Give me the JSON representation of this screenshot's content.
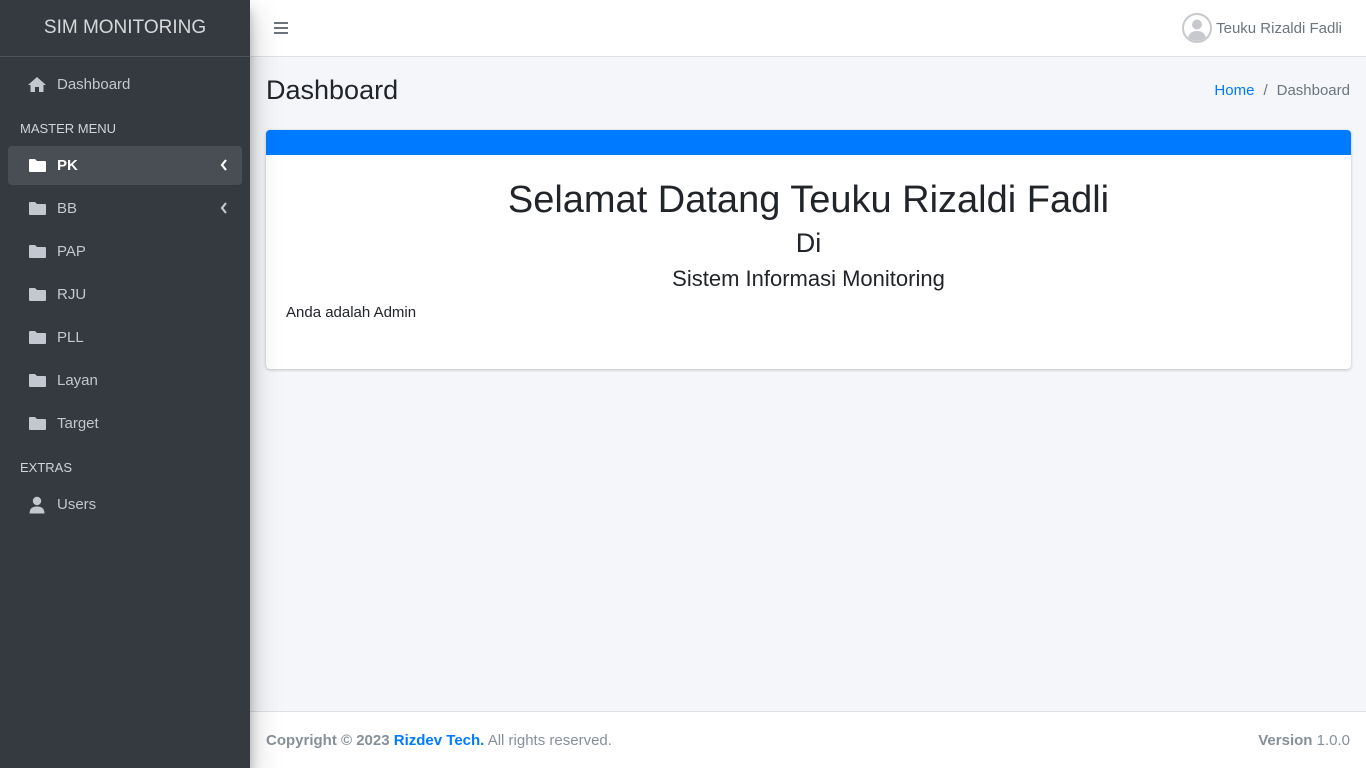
{
  "brand": {
    "title": "SIM MONITORING"
  },
  "sidebar": {
    "dashboard": {
      "label": "Dashboard",
      "icon": "home-icon"
    },
    "master_header": "MASTER MENU",
    "items": [
      {
        "label": "PK",
        "icon": "folder-icon",
        "active": true,
        "has_submenu": true
      },
      {
        "label": "BB",
        "icon": "folder-icon",
        "active": false,
        "has_submenu": true
      },
      {
        "label": "PAP",
        "icon": "folder-icon",
        "active": false,
        "has_submenu": false
      },
      {
        "label": "RJU",
        "icon": "folder-icon",
        "active": false,
        "has_submenu": false
      },
      {
        "label": "PLL",
        "icon": "folder-icon",
        "active": false,
        "has_submenu": false
      },
      {
        "label": "Layan",
        "icon": "folder-icon",
        "active": false,
        "has_submenu": false
      },
      {
        "label": "Target",
        "icon": "folder-icon",
        "active": false,
        "has_submenu": false
      }
    ],
    "extras_header": "EXTRAS",
    "users": {
      "label": "Users",
      "icon": "user-icon"
    }
  },
  "topbar": {
    "menu_icon": "hamburger-icon",
    "user_name": "Teuku Rizaldi Fadli"
  },
  "content": {
    "title": "Dashboard",
    "breadcrumb": {
      "home": "Home",
      "separator": "/",
      "current": "Dashboard"
    }
  },
  "card": {
    "welcome": "Selamat Datang Teuku Rizaldi Fadli",
    "di": "Di",
    "system": "Sistem Informasi Monitoring",
    "role": "Anda adalah Admin"
  },
  "footer": {
    "copyright_prefix": "Copyright © 2023",
    "company": "Rizdev Tech.",
    "rights": "All rights reserved.",
    "version_label": "Version",
    "version_value": "1.0.0"
  },
  "colors": {
    "sidebar_bg": "#343a40",
    "accent": "#007bff",
    "content_bg": "#f4f6f9"
  }
}
